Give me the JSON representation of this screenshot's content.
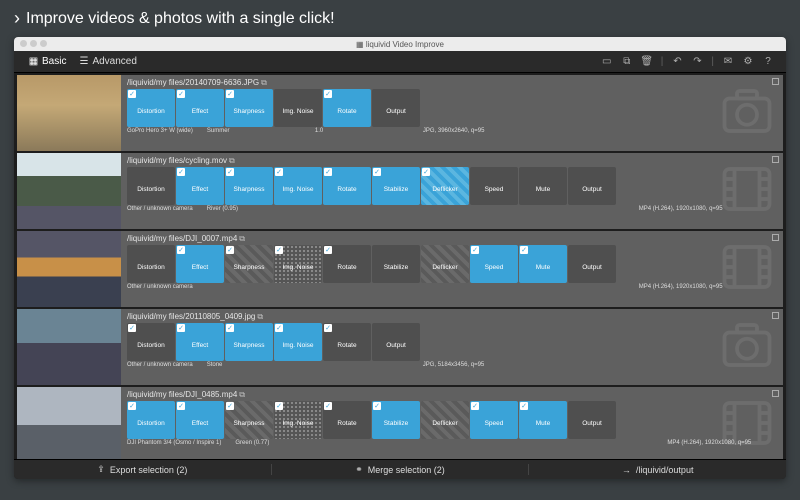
{
  "header": {
    "title": "Improve videos & photos with a single click!"
  },
  "window": {
    "title": "liquivid Video Improve"
  },
  "toolbar": {
    "basic": "Basic",
    "advanced": "Advanced"
  },
  "tracks": [
    {
      "path": "/liquivid/my files/20140709-6636.JPG",
      "thumb": "th1",
      "type": "photo",
      "nodes": [
        {
          "label": "Distortion",
          "state": "on",
          "chk": true
        },
        {
          "label": "Effect",
          "state": "on",
          "chk": true
        },
        {
          "label": "Sharpness",
          "state": "on",
          "chk": true
        },
        {
          "label": "Img. Noise",
          "state": "off",
          "chk": false
        },
        {
          "label": "Rotate",
          "state": "on",
          "chk": true
        },
        {
          "label": "Output",
          "state": "off",
          "chk": false
        }
      ],
      "meta": [
        "GoPro Hero 3+ W (wide)",
        "Summer",
        "",
        "1.0",
        "",
        "JPG, 3960x2640, q=95"
      ]
    },
    {
      "path": "/liquivid/my files/cycling.mov",
      "thumb": "th2",
      "type": "video",
      "nodes": [
        {
          "label": "Distortion",
          "state": "off",
          "chk": false
        },
        {
          "label": "Effect",
          "state": "on",
          "chk": true
        },
        {
          "label": "Sharpness",
          "state": "on",
          "chk": true
        },
        {
          "label": "Img. Noise",
          "state": "on",
          "chk": true
        },
        {
          "label": "Rotate",
          "state": "on",
          "chk": true
        },
        {
          "label": "Stabilize",
          "state": "on",
          "chk": true
        },
        {
          "label": "Deflicker",
          "state": "pat2",
          "chk": true
        },
        {
          "label": "Speed",
          "state": "off",
          "chk": false
        },
        {
          "label": "Mute",
          "state": "off",
          "chk": false
        },
        {
          "label": "Output",
          "state": "off",
          "chk": false
        }
      ],
      "meta": [
        "Other / unknown camera",
        "River (0.95)",
        "",
        "",
        "",
        "",
        "",
        "",
        "",
        "MP4 (H.264), 1920x1080, q=95"
      ]
    },
    {
      "path": "/liquivid/my files/DJI_0007.mp4",
      "thumb": "th3",
      "type": "video",
      "nodes": [
        {
          "label": "Distortion",
          "state": "off",
          "chk": false
        },
        {
          "label": "Effect",
          "state": "on",
          "chk": true
        },
        {
          "label": "Sharpness",
          "state": "pat",
          "chk": true
        },
        {
          "label": "Img. Noise",
          "state": "noise",
          "chk": true
        },
        {
          "label": "Rotate",
          "state": "off",
          "chk": true
        },
        {
          "label": "Stabilize",
          "state": "off",
          "chk": false
        },
        {
          "label": "Deflicker",
          "state": "pat",
          "chk": false
        },
        {
          "label": "Speed",
          "state": "on",
          "chk": true
        },
        {
          "label": "Mute",
          "state": "on",
          "chk": true
        },
        {
          "label": "Output",
          "state": "off",
          "chk": false
        }
      ],
      "meta": [
        "Other / unknown camera",
        "",
        "",
        "",
        "",
        "",
        "",
        "",
        "",
        "MP4 (H.264), 1920x1080, q=95"
      ]
    },
    {
      "path": "/liquivid/my files/20110805_0409.jpg",
      "thumb": "th4",
      "type": "photo",
      "nodes": [
        {
          "label": "Distortion",
          "state": "off",
          "chk": true
        },
        {
          "label": "Effect",
          "state": "on",
          "chk": true
        },
        {
          "label": "Sharpness",
          "state": "on",
          "chk": true
        },
        {
          "label": "Img. Noise",
          "state": "on",
          "chk": true
        },
        {
          "label": "Rotate",
          "state": "off",
          "chk": true
        },
        {
          "label": "Output",
          "state": "off",
          "chk": false
        }
      ],
      "meta": [
        "Other / unknown camera",
        "Stone",
        "",
        "",
        "",
        "JPG, 5184x3456, q=95"
      ]
    },
    {
      "path": "/liquivid/my files/DJI_0485.mp4",
      "thumb": "th5",
      "type": "video",
      "nodes": [
        {
          "label": "Distortion",
          "state": "on",
          "chk": true
        },
        {
          "label": "Effect",
          "state": "on",
          "chk": true
        },
        {
          "label": "Sharpness",
          "state": "pat",
          "chk": true
        },
        {
          "label": "Img. Noise",
          "state": "noise",
          "chk": true
        },
        {
          "label": "Rotate",
          "state": "off",
          "chk": true
        },
        {
          "label": "Stabilize",
          "state": "on",
          "chk": true
        },
        {
          "label": "Deflicker",
          "state": "pat",
          "chk": false
        },
        {
          "label": "Speed",
          "state": "on",
          "chk": true
        },
        {
          "label": "Mute",
          "state": "on",
          "chk": true
        },
        {
          "label": "Output",
          "state": "off",
          "chk": false
        }
      ],
      "meta": [
        "DJI Phantom 3/4 (Osmo / Inspire 1)",
        "Green (0.77)",
        "",
        "",
        "",
        "",
        "",
        "",
        "",
        "MP4 (H.264), 1920x1080, q=95"
      ]
    }
  ],
  "footer": {
    "export": "Export selection (2)",
    "merge": "Merge selection (2)",
    "output": "/liquivid/output"
  }
}
